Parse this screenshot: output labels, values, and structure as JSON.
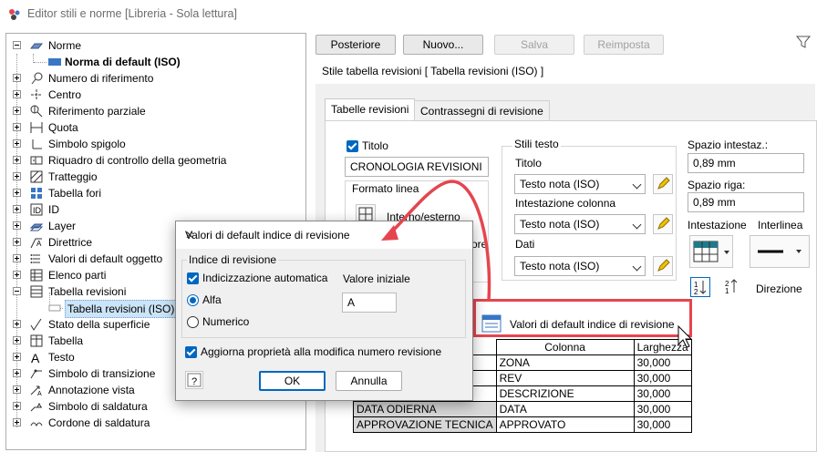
{
  "window": {
    "title": "Editor stili e norme [Libreria - Sola lettura]"
  },
  "tree": {
    "items": [
      {
        "label": "Norme",
        "icon": "norme-icon"
      },
      {
        "label": "Norma di default (ISO)",
        "icon": "standard-icon"
      },
      {
        "label": "Numero di riferimento",
        "icon": "balloon-icon"
      },
      {
        "label": "Centro",
        "icon": "center-mark-icon"
      },
      {
        "label": "Riferimento parziale",
        "icon": "datum-target-icon"
      },
      {
        "label": "Quota",
        "icon": "dimension-icon"
      },
      {
        "label": "Simbolo spigolo",
        "icon": "edge-symbol-icon"
      },
      {
        "label": "Riquadro di controllo della geometria",
        "icon": "feature-control-frame-icon"
      },
      {
        "label": "Tratteggio",
        "icon": "hatch-icon"
      },
      {
        "label": "Tabella fori",
        "icon": "hole-table-icon"
      },
      {
        "label": "ID",
        "icon": "id-icon"
      },
      {
        "label": "Layer",
        "icon": "layer-icon"
      },
      {
        "label": "Direttrice",
        "icon": "leader-icon"
      },
      {
        "label": "Valori di default oggetto",
        "icon": "object-defaults-icon"
      },
      {
        "label": "Elenco parti",
        "icon": "parts-list-icon"
      },
      {
        "label": "Tabella revisioni",
        "icon": "revision-table-icon"
      },
      {
        "label": "Tabella revisioni (ISO)",
        "icon": "revision-table-style-icon"
      },
      {
        "label": "Stato della superficie",
        "icon": "surface-texture-icon"
      },
      {
        "label": "Tabella",
        "icon": "table-icon"
      },
      {
        "label": "Testo",
        "icon": "text-icon"
      },
      {
        "label": "Simbolo di transizione",
        "icon": "transition-symbol-icon"
      },
      {
        "label": "Annotazione vista",
        "icon": "view-annotation-icon"
      },
      {
        "label": "Simbolo di saldatura",
        "icon": "weld-symbol-icon"
      },
      {
        "label": "Cordone di saldatura",
        "icon": "weld-bead-icon"
      }
    ]
  },
  "toolbar": {
    "back": "Posteriore",
    "new": "Nuovo...",
    "save": "Salva",
    "reset": "Reimposta",
    "filter_icon": "filter-icon"
  },
  "style_header": "Stile tabella revisioni [ Tabella revisioni (ISO) ]",
  "tabs": [
    "Tabelle revisioni",
    "Contrassegni di revisione"
  ],
  "form": {
    "title_check": "Titolo",
    "title_value": "CRONOLOGIA REVISIONI",
    "line_format": "Formato linea",
    "line_interior_exterior": "Interno/esterno",
    "line_partial": "ore",
    "text_styles": "Stili testo",
    "title_label": "Titolo",
    "title_style": "Testo nota (ISO)",
    "col_header_label": "Intestazione colonna",
    "col_header_style": "Testo nota (ISO)",
    "data_label": "Dati",
    "data_style": "Testo nota (ISO)",
    "header_spacing_label": "Spazio intestaz.:",
    "header_spacing_value": "0,89 mm",
    "row_spacing_label": "Spazio riga:",
    "row_spacing_value": "0,89 mm",
    "header_label": "Intestazione",
    "line_spacing_label": "Interlinea",
    "direction_label": "Direzione",
    "defaults_button": "Valori di default indice di revisione"
  },
  "columns_table": {
    "headers": [
      "Colonna",
      "Larghezza"
    ],
    "rows": [
      [
        "",
        "ZONA",
        "30,000"
      ],
      [
        "",
        "REV",
        "30,000"
      ],
      [
        "",
        "DESCRIZIONE",
        "30,000"
      ],
      [
        "DATA ODIERNA",
        "DATA",
        "30,000"
      ],
      [
        "APPROVAZIONE TECNICA",
        "APPROVATO",
        "30,000"
      ]
    ]
  },
  "dialog": {
    "title": "Valori di default indice di revisione",
    "group": "Indice di revisione",
    "auto_index": "Indicizzazione automatica",
    "initial_value_label": "Valore iniziale",
    "initial_value": "A",
    "alpha": "Alfa",
    "numeric": "Numerico",
    "update_props": "Aggiorna proprietà alla modifica numero revisione",
    "ok": "OK",
    "cancel": "Annulla"
  },
  "colors": {
    "accent": "#0067c0",
    "highlight": "#e5454f",
    "selection": "#cce4f7"
  }
}
